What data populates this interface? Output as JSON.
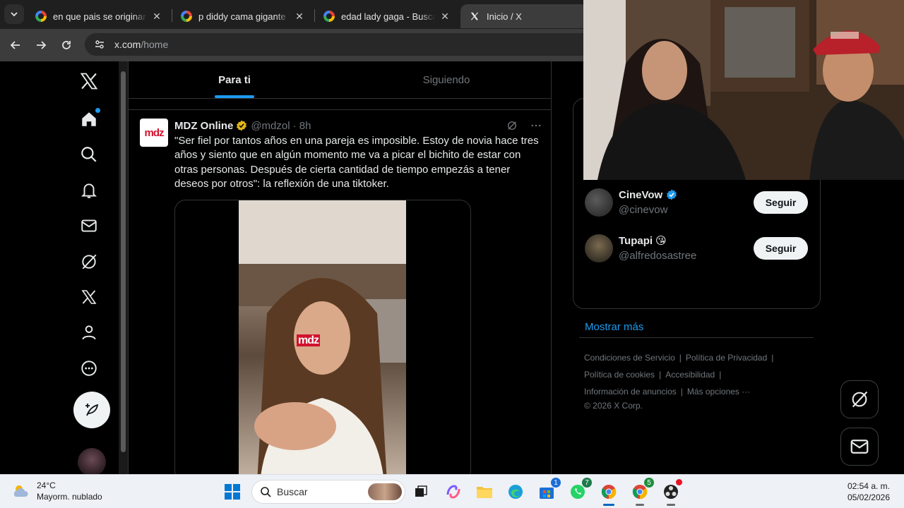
{
  "browser": {
    "tabs": [
      {
        "title": "en que pais se originaron",
        "active": false
      },
      {
        "title": "p diddy cama gigante fot",
        "active": false
      },
      {
        "title": "edad lady gaga - Buscar",
        "active": false
      },
      {
        "title": "Inicio / X",
        "active": true
      }
    ],
    "url_host": "x.com",
    "url_path": "/home"
  },
  "timeline": {
    "tabs": [
      {
        "label": "Para ti",
        "selected": true
      },
      {
        "label": "Siguiendo",
        "selected": false
      }
    ]
  },
  "post": {
    "avatar_text": "mdz",
    "name": "MDZ Online",
    "handle": "@mdzol",
    "time": "· 8h",
    "text": "\"Ser fiel por tantos años en una pareja es imposible. Estoy de novia hace tres años y siento que en algún momento me va a picar el bichito de estar con otras personas. Después de cierta cantidad de tiempo empezás a tener deseos por otros\": la reflexión de una tiktoker.",
    "media_watermark": "mdz"
  },
  "who_to_follow": {
    "accounts": [
      {
        "name": "CineVow",
        "handle": "@cinevow",
        "verified": true,
        "emoji": "",
        "button": "Seguir"
      },
      {
        "name": "Tupapi",
        "handle": "@alfredosastree",
        "verified": false,
        "emoji": "😘",
        "button": "Seguir"
      }
    ],
    "show_more": "Mostrar más"
  },
  "footer": {
    "links_row1": [
      "Condiciones de Servicio",
      "|",
      "Política de Privacidad",
      "|"
    ],
    "links_row2": [
      "Política de cookies",
      "|",
      "Accesibilidad",
      "|"
    ],
    "links_row3": [
      "Información de anuncios",
      "|",
      "Más opciones ···"
    ],
    "copyright": "© 2026 X Corp."
  },
  "taskbar": {
    "weather_temp": "24°C",
    "weather_desc": "Mayorm. nublado",
    "search_placeholder": "Buscar",
    "time": "02:54 a. m.",
    "date": "05/02/2026",
    "badges": {
      "store": "1",
      "whatsapp": "7",
      "chrome2": "5"
    }
  },
  "colors": {
    "accent": "#1d9bf0",
    "background": "#000000",
    "text": "#e7e9ea",
    "muted": "#71767b",
    "verified_gold": "#e2b719"
  }
}
